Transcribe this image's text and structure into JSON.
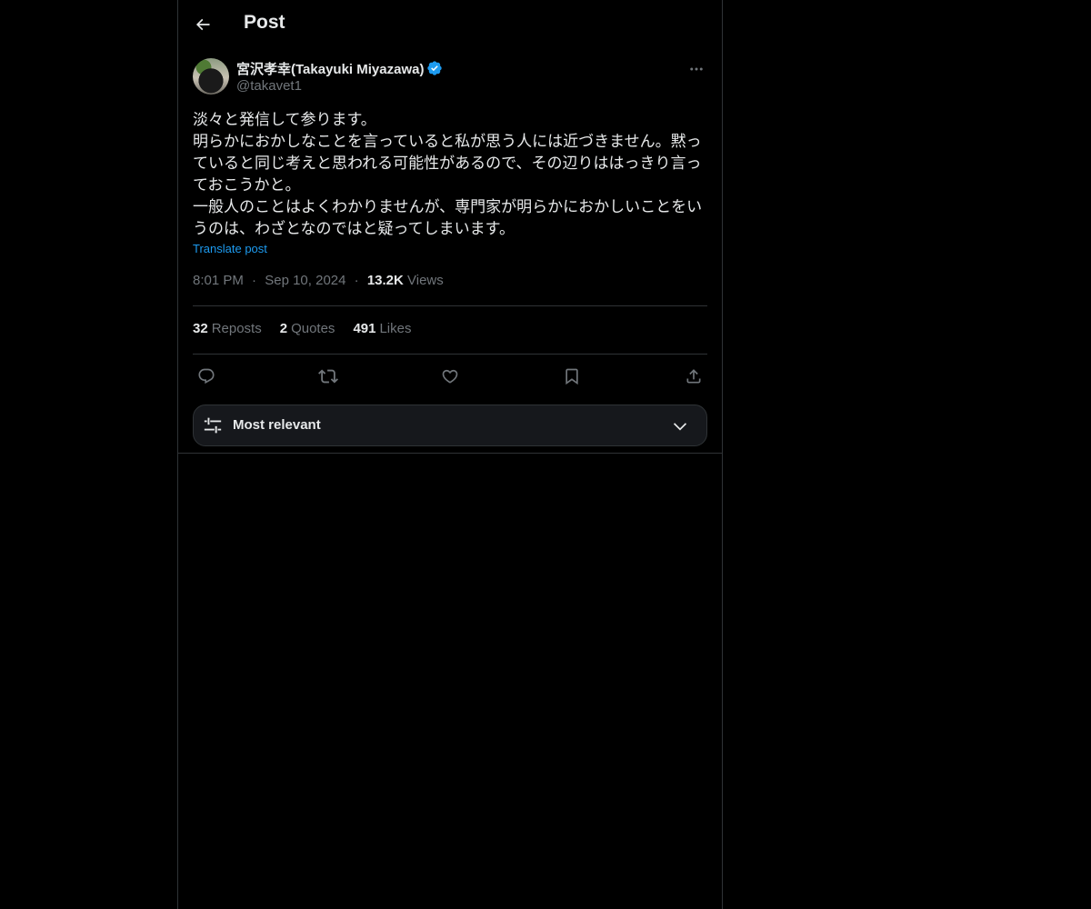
{
  "header": {
    "title": "Post"
  },
  "post": {
    "author": {
      "display_name": "宮沢孝幸(Takayuki Miyazawa)",
      "handle": "@takavet1",
      "verified": true
    },
    "text_lines": [
      "淡々と発信して参ります。",
      "明らかにおかしなことを言っていると私が思う人には近づきません。黙っ",
      "ていると同じ考えと思われる可能性があるので、その辺りははっきり言っ",
      "ておこうかと。",
      "一般人のことはよくわかりませんが、専門家が明らかにおかしいことをい",
      "うのは、わざとなのではと疑ってしまいます。"
    ],
    "translate_label": "Translate post",
    "time": "8:01 PM",
    "date": "Sep 10, 2024",
    "separator": "·",
    "views_count": "13.2K",
    "views_label": "Views"
  },
  "stats": {
    "reposts_count": "32",
    "reposts_label": "Reposts",
    "quotes_count": "2",
    "quotes_label": "Quotes",
    "likes_count": "491",
    "likes_label": "Likes"
  },
  "actions": [
    "reply-icon",
    "repost-icon",
    "like-icon",
    "bookmark-icon",
    "share-icon"
  ],
  "sort": {
    "label": "Most relevant"
  },
  "colors": {
    "background": "#000000",
    "text": "#e7e9ea",
    "secondary": "#71767b",
    "accent": "#1d9bf0",
    "border": "#2f3336"
  }
}
